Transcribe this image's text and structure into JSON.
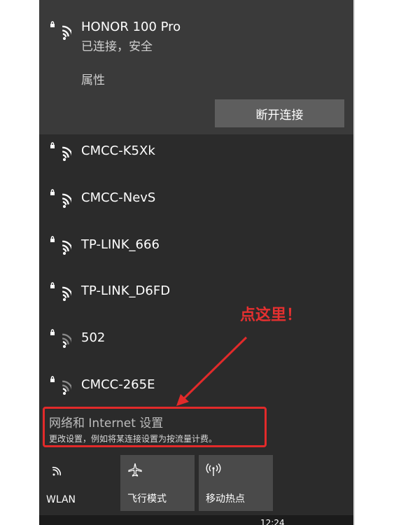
{
  "connected_network": {
    "name": "HONOR 100 Pro",
    "status": "已连接，安全",
    "properties_label": "属性",
    "disconnect_label": "断开连接"
  },
  "networks": [
    {
      "name": "CMCC-K5Xk",
      "icon": "wifi-secured-icon"
    },
    {
      "name": "CMCC-NevS",
      "icon": "wifi-secured-icon"
    },
    {
      "name": "TP-LINK_666",
      "icon": "wifi-secured-icon"
    },
    {
      "name": "TP-LINK_D6FD",
      "icon": "wifi-secured-icon"
    },
    {
      "name": "502",
      "icon": "wifi-secured-weak-icon"
    },
    {
      "name": "CMCC-265E",
      "icon": "wifi-secured-weak-icon"
    }
  ],
  "network_settings": {
    "title": "网络和 Internet 设置",
    "description": "更改设置，例如将某连接设置为按流量计费。"
  },
  "quick_actions": [
    {
      "label": "WLAN",
      "icon": "wifi-icon",
      "active": true
    },
    {
      "label": "飞行模式",
      "icon": "airplane-icon",
      "active": false
    },
    {
      "label": "移动热点",
      "icon": "hotspot-icon",
      "active": false
    }
  ],
  "taskbar": {
    "time": "12:24"
  },
  "annotation": {
    "text": "点这里！",
    "color": "#e53030"
  },
  "colors": {
    "panel_bg": "#2b2b2b",
    "connected_bg": "#3a3a3a",
    "button_bg": "#5e5e5e",
    "tile_active_bg": "#2b2b2b",
    "tile_inactive_bg": "#4a4a4a",
    "highlight": "#e22a2a"
  }
}
